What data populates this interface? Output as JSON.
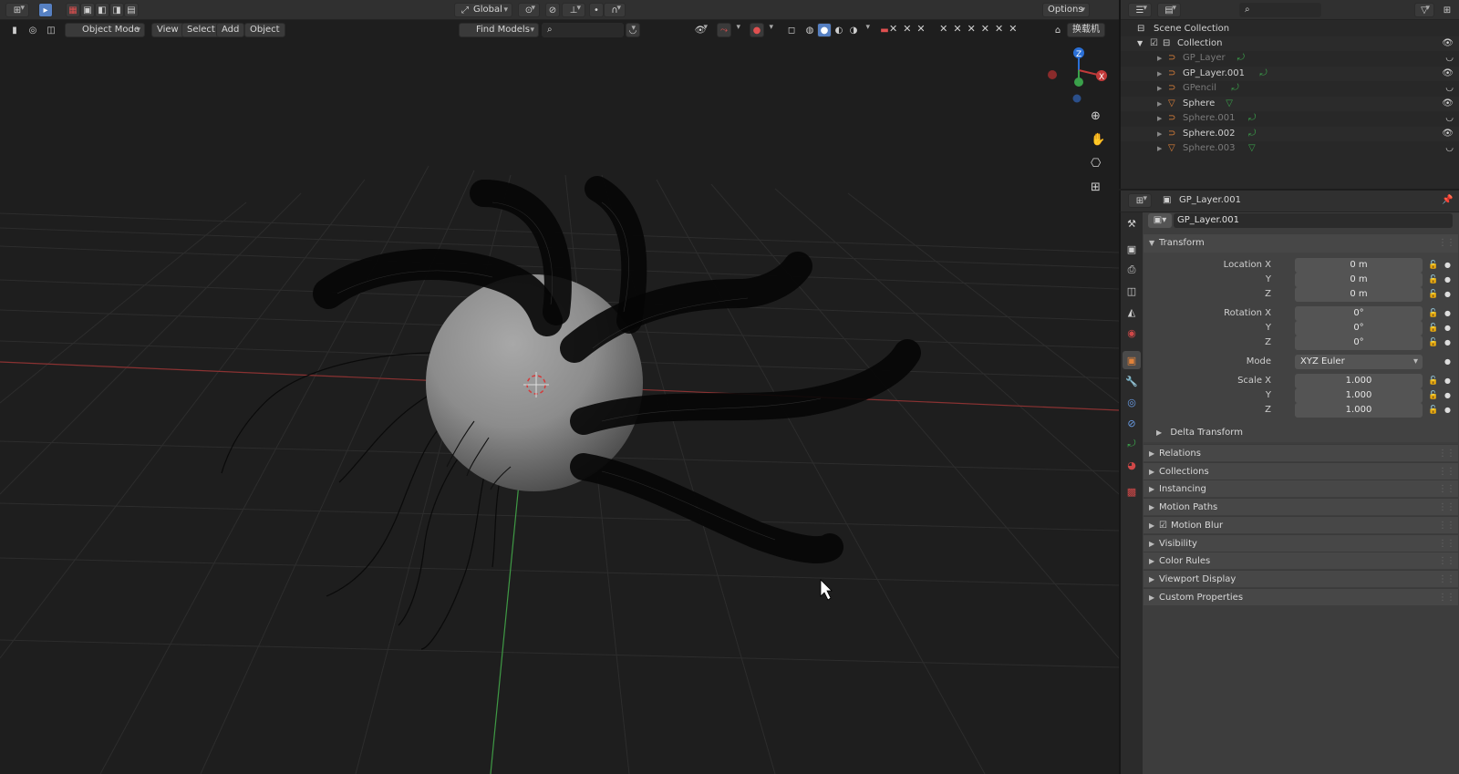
{
  "topbar": {
    "orientation": "Global",
    "options_label": "Options"
  },
  "viewport_header": {
    "mode": "Object Mode",
    "menus": [
      "View",
      "Select",
      "Add",
      "Object"
    ],
    "find_models": "Find Models",
    "search_placeholder": "",
    "right_label": "换载机"
  },
  "outliner": {
    "root": "Scene Collection",
    "collection": "Collection",
    "items": [
      {
        "name": "GP_Layer",
        "kind": "grease-pencil",
        "visible": false
      },
      {
        "name": "GP_Layer.001",
        "kind": "grease-pencil",
        "visible": true
      },
      {
        "name": "GPencil",
        "kind": "grease-pencil",
        "visible": false
      },
      {
        "name": "Sphere",
        "kind": "mesh",
        "visible": true
      },
      {
        "name": "Sphere.001",
        "kind": "grease-pencil",
        "visible": false
      },
      {
        "name": "Sphere.002",
        "kind": "grease-pencil",
        "visible": true
      },
      {
        "name": "Sphere.003",
        "kind": "mesh",
        "visible": false
      }
    ]
  },
  "properties": {
    "header_object": "GP_Layer.001",
    "object_name": "GP_Layer.001",
    "transform_label": "Transform",
    "location_label": "Location X",
    "rotation_label": "Rotation X",
    "scale_label": "Scale X",
    "mode_label": "Mode",
    "y_label": "Y",
    "z_label": "Z",
    "location": [
      "0 m",
      "0 m",
      "0 m"
    ],
    "rotation": [
      "0°",
      "0°",
      "0°"
    ],
    "mode": "XYZ Euler",
    "scale": [
      "1.000",
      "1.000",
      "1.000"
    ],
    "delta_transform": "Delta Transform",
    "panels": [
      "Relations",
      "Collections",
      "Instancing",
      "Motion Paths",
      "Motion Blur",
      "Visibility",
      "Color Rules",
      "Viewport Display",
      "Custom Properties"
    ]
  },
  "colors": {
    "accent_active": "#5680c2",
    "axis_x": "#c04040",
    "axis_y": "#4ca040",
    "object_orange": "#e0823a"
  }
}
